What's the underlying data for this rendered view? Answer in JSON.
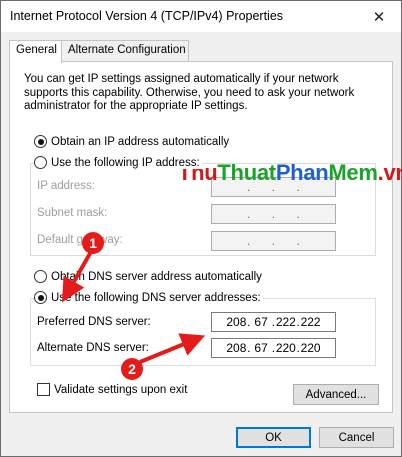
{
  "window": {
    "title": "Internet Protocol Version 4 (TCP/IPv4) Properties",
    "close_glyph": "✕"
  },
  "tabs": [
    {
      "label": "General",
      "active": true
    },
    {
      "label": "Alternate Configuration",
      "active": false
    }
  ],
  "description": "You can get IP settings assigned automatically if your network supports this capability. Otherwise, you need to ask your network administrator for the appropriate IP settings.",
  "ip_section": {
    "auto_label": "Obtain an IP address automatically",
    "auto_selected": true,
    "manual_label": "Use the following IP address:",
    "manual_selected": false,
    "fields": [
      {
        "label": "IP address:",
        "value": [
          "",
          "",
          "",
          ""
        ]
      },
      {
        "label": "Subnet mask:",
        "value": [
          "",
          "",
          "",
          ""
        ]
      },
      {
        "label": "Default gateway:",
        "value": [
          "",
          "",
          "",
          ""
        ]
      }
    ]
  },
  "dns_section": {
    "auto_label": "Obtain DNS server address automatically",
    "auto_selected": false,
    "manual_label": "Use the following DNS server addresses:",
    "manual_selected": true,
    "preferred": {
      "label": "Preferred DNS server:",
      "value": [
        "208",
        "67",
        "222",
        "222"
      ]
    },
    "alternate": {
      "label": "Alternate DNS server:",
      "value": [
        "208",
        "67",
        "220",
        "220"
      ]
    }
  },
  "validate": {
    "label": "Validate settings upon exit",
    "checked": false
  },
  "buttons": {
    "advanced": "Advanced...",
    "ok": "OK",
    "cancel": "Cancel"
  },
  "watermark": {
    "parts": [
      {
        "text": "Thu",
        "color": "#d11a1a"
      },
      {
        "text": "Thuat",
        "color": "#1aa32b"
      },
      {
        "text": "Phan",
        "color": "#1f5fd1"
      },
      {
        "text": "Mem",
        "color": "#1aa32b"
      },
      {
        "text": ".vn",
        "color": "#d11a1a"
      }
    ]
  },
  "annotations": {
    "marker_1": "1",
    "marker_2": "2",
    "color": "#e51b1b"
  }
}
